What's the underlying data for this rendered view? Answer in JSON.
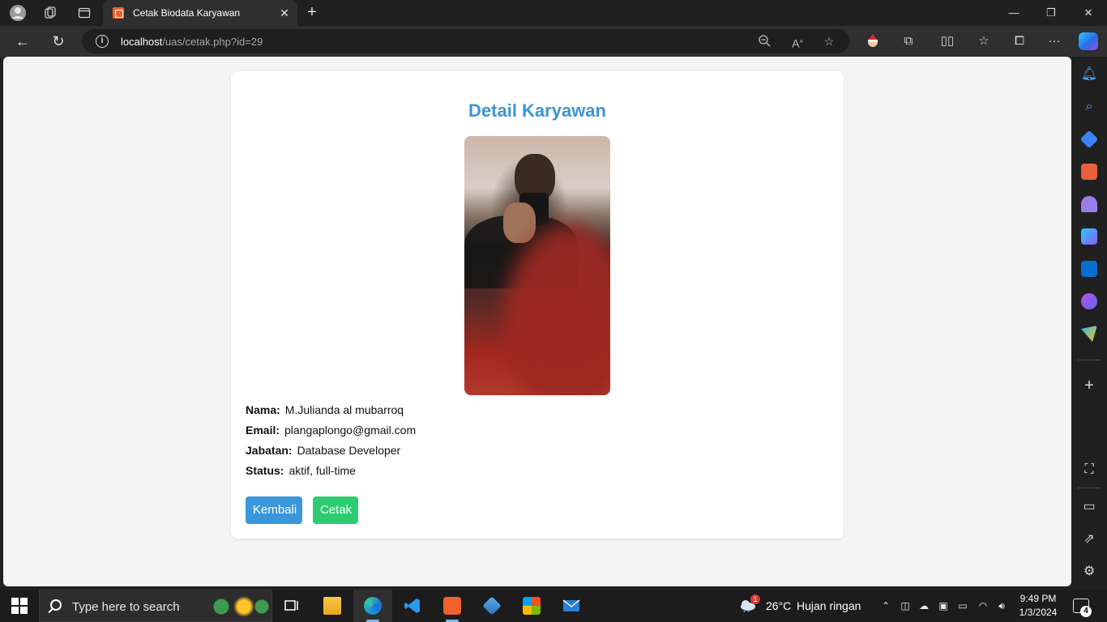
{
  "browser": {
    "tab_title": "Cetak Biodata Karyawan",
    "url_host": "localhost",
    "url_path": "/uas/cetak.php?id=29"
  },
  "page": {
    "title": "Detail Karyawan",
    "photo_alt": "Foto karyawan",
    "fields": [
      {
        "label": "Nama:",
        "value": "M.Julianda al mubarroq"
      },
      {
        "label": "Email:",
        "value": "plangaplongo@gmail.com"
      },
      {
        "label": "Jabatan:",
        "value": "Database Developer"
      },
      {
        "label": "Status:",
        "value": "aktif, full-time"
      }
    ],
    "buttons": {
      "back": "Kembali",
      "print": "Cetak"
    },
    "colors": {
      "title": "#3b94d4",
      "back_button": "#3a97dc",
      "print_button": "#2ecc71"
    }
  },
  "taskbar": {
    "search_placeholder": "Type here to search",
    "weather_temp": "26°C",
    "weather_desc": "Hujan ringan",
    "weather_badge": "1",
    "time": "9:49 PM",
    "date": "1/3/2024",
    "notification_count": "4"
  }
}
